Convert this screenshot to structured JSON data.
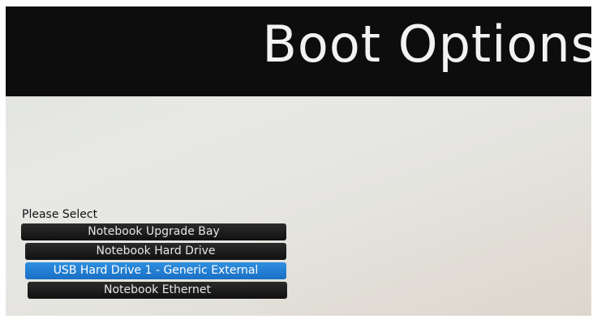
{
  "header": {
    "title": "Boot Options"
  },
  "menu": {
    "prompt": "Please Select",
    "items": [
      {
        "label": "Notebook Upgrade Bay",
        "selected": false
      },
      {
        "label": "Notebook Hard Drive",
        "selected": false
      },
      {
        "label": "USB Hard Drive 1 - Generic External",
        "selected": true
      },
      {
        "label": "Notebook Ethernet",
        "selected": false
      }
    ]
  },
  "colors": {
    "header_background": "#0d0d0d",
    "item_background": "#1a1a1a",
    "selected_background": "#1f7fd6",
    "text_light": "#f2f2f2"
  }
}
